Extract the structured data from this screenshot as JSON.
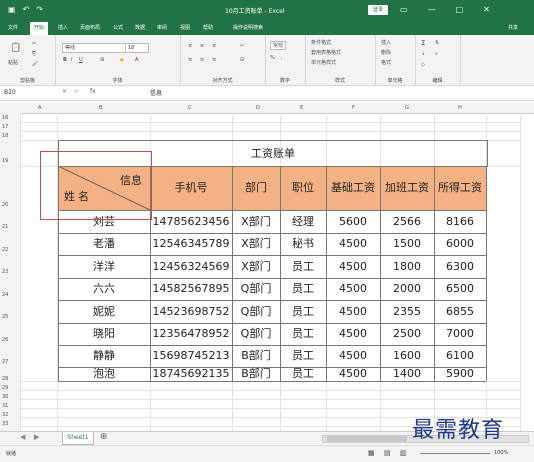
{
  "window": {
    "title": "10月工资账单 - Excel",
    "login": "登录",
    "controls": [
      "▭",
      "—",
      "□",
      "✕"
    ]
  },
  "tabs": [
    "文件",
    "开始",
    "插入",
    "页面布局",
    "公式",
    "数据",
    "审阅",
    "视图",
    "帮助",
    "操作说明搜索",
    "共享"
  ],
  "ribbon": {
    "clipboard_label": "剪贴板",
    "font_label": "字体",
    "align_label": "对齐方式",
    "number_label": "数字",
    "style_label": "样式",
    "cells_label": "单元格",
    "edit_label": "编辑",
    "font_name": "等线",
    "font_size": "18",
    "cond_format": "条件格式",
    "table_format": "套用表格格式",
    "cell_style": "单元格样式",
    "insert": "插入",
    "delete": "删除",
    "format": "格式",
    "number_format": "常规",
    "paste": "粘贴"
  },
  "formula_bar": {
    "name_box": "B20",
    "fx": "fx",
    "value": "信息"
  },
  "columns": [
    "A",
    "B",
    "C",
    "D",
    "E",
    "F",
    "G",
    "H"
  ],
  "rows": [
    "16",
    "17",
    "18",
    "19",
    "20",
    "21",
    "22",
    "23",
    "24",
    "25",
    "26",
    "27",
    "28",
    "29",
    "30",
    "31",
    "32",
    "33"
  ],
  "table": {
    "title": "工资账单",
    "header_corner_top": "信息",
    "header_corner_bottom": "姓名",
    "headers": [
      "手机号",
      "部门",
      "职位",
      "基础工资",
      "加班工资",
      "所得工资"
    ],
    "rows": [
      [
        "刘芸",
        "14785623456",
        "X部门",
        "经理",
        "5600",
        "2566",
        "8166"
      ],
      [
        "老潘",
        "12546345789",
        "X部门",
        "秘书",
        "4500",
        "1500",
        "6000"
      ],
      [
        "洋洋",
        "12456324569",
        "X部门",
        "员工",
        "4500",
        "1800",
        "6300"
      ],
      [
        "六六",
        "14582567895",
        "Q部门",
        "员工",
        "4500",
        "2000",
        "6500"
      ],
      [
        "妮妮",
        "14523698752",
        "Q部门",
        "员工",
        "4500",
        "2355",
        "6855"
      ],
      [
        "晓阳",
        "12356478952",
        "Q部门",
        "员工",
        "4500",
        "2500",
        "7000"
      ],
      [
        "静静",
        "15698745213",
        "B部门",
        "员工",
        "4500",
        "1600",
        "6100"
      ],
      [
        "泡泡",
        "18745692135",
        "B部门",
        "员工",
        "4500",
        "1400",
        "5900"
      ]
    ]
  },
  "sheet_tab": "Sheet1",
  "status": {
    "mode": "就绪",
    "zoom": "100%"
  },
  "watermark": "最需教育"
}
